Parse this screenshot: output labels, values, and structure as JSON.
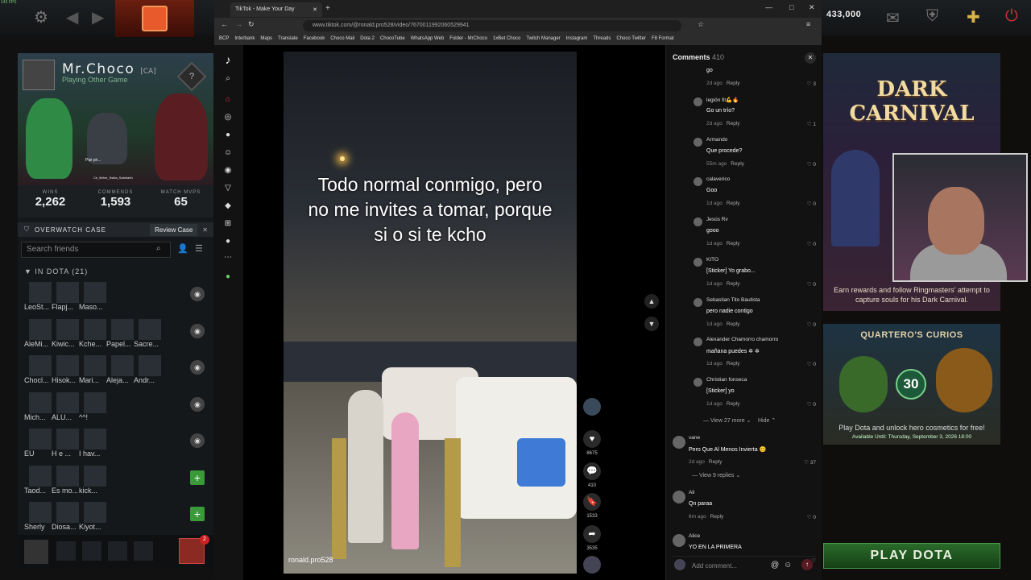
{
  "fps": "143 FPS",
  "gold": "433,000",
  "profile": {
    "name": "Mr.Choco",
    "tag": "[CA]",
    "status": "Playing Other Game",
    "bubble1": "Pipi pri...",
    "bubble2": "Ce_fiebre_Ssiba_Sabelahh"
  },
  "stats": [
    {
      "label": "WINS",
      "value": "2,262"
    },
    {
      "label": "COMMENDS",
      "value": "1,593"
    },
    {
      "label": "MATCH MVPS",
      "value": "65"
    }
  ],
  "overwatch": {
    "title": "OVERWATCH CASE",
    "review": "Review Case"
  },
  "friends": {
    "search_placeholder": "Search friends",
    "group": "IN DOTA (21)",
    "rows": [
      {
        "names": [
          "LeoSt...",
          "Flapj...",
          "Maso..."
        ]
      },
      {
        "names": [
          "AleMi...",
          "Kiwic...",
          "Kche...",
          "Papel...",
          "Sacre..."
        ]
      },
      {
        "names": [
          "Chocl...",
          "Hisok...",
          "Mari...",
          "Aleja...",
          "Andr..."
        ]
      },
      {
        "names": [
          "Mich...",
          "ALU...",
          "^^!"
        ]
      },
      {
        "names": [
          "EU",
          "H e ...",
          "I hav..."
        ]
      },
      {
        "names": [
          "Taod...",
          "Es mo...",
          "kick..."
        ]
      },
      {
        "names": [
          "Sherly",
          "Diosa...",
          "Kiyot..."
        ]
      }
    ]
  },
  "bottom_badge": "2",
  "browser": {
    "tab": "TikTok - Make Your Day",
    "url": "www.tiktok.com/@ronald.pro528/video/7670011992060529941",
    "bookmarks": [
      "BCP",
      "Interbank",
      "Maps",
      "Translate",
      "Facebook",
      "Choco Mail",
      "Dota 2",
      "ChocoTube",
      "WhatsApp Web",
      "Folder - MrChoco",
      "1xBet Choco",
      "Twitch Manager",
      "Instagram",
      "Threads",
      "Choco Twitter",
      "F8 Format"
    ]
  },
  "video": {
    "caption": "Todo normal conmigo, pero no me invites a tomar, porque si o si te kcho",
    "username": "ronald.pro528",
    "likes": "8675",
    "comments": "410",
    "saves": "1533",
    "shares": "3535"
  },
  "comments": {
    "title": "Comments",
    "count": "410",
    "placeholder": "Add comment...",
    "replies": [
      {
        "user": "",
        "text": "go",
        "meta": "2d ago",
        "reply": "Reply",
        "likes": "3"
      },
      {
        "user": "legión fit💪🔥",
        "text": "Go un trío?",
        "meta": "2d ago",
        "reply": "Reply",
        "likes": "1"
      },
      {
        "user": "Armando",
        "text": "Que procede?",
        "meta": "55m ago",
        "reply": "Reply",
        "likes": "0"
      },
      {
        "user": "calaverico",
        "text": "Goo",
        "meta": "1d ago",
        "reply": "Reply",
        "likes": "0"
      },
      {
        "user": "Jesús Rv",
        "text": "gooo",
        "meta": "1d ago",
        "reply": "Reply",
        "likes": "0"
      },
      {
        "user": "KITO",
        "text": "[Sticker] Yo grabo...",
        "meta": "1d ago",
        "reply": "Reply",
        "likes": "0"
      },
      {
        "user": "Sebastian Tito Bautista",
        "text": "pero nadie contigo",
        "meta": "1d ago",
        "reply": "Reply",
        "likes": "0"
      },
      {
        "user": "Alexander Chamorro chamorro",
        "text": "mañana puedes ✲ ✲",
        "meta": "1d ago",
        "reply": "Reply",
        "likes": "0"
      },
      {
        "user": "Christian fonseca",
        "text": "[Sticker] yo",
        "meta": "1d ago",
        "reply": "Reply",
        "likes": "0"
      }
    ],
    "view_more": "View 27 more",
    "hide": "Hide",
    "top": [
      {
        "user": "vane",
        "text": "Pero Que Al Menos Invierta 😊",
        "meta": "2d ago",
        "reply": "Reply",
        "likes": "37",
        "view": "View 9 replies"
      },
      {
        "user": "Ali",
        "text": "Qn paraa",
        "meta": "6m ago",
        "reply": "Reply",
        "likes": "0"
      },
      {
        "user": "Alice",
        "text": "YO EN LA PRIMERA",
        "meta": "",
        "reply": "",
        "likes": ""
      }
    ]
  },
  "event": {
    "title_line1": "DARK",
    "title_line2": "CARNIVAL",
    "text": "Earn rewards and follow Ringmasters' attempt to capture souls for his Dark Carnival."
  },
  "curios": {
    "title": "QUARTERO'S CURIOS",
    "badge": "30",
    "text": "Play Dota and unlock hero cosmetics for free!",
    "avail": "Available Until: Thursday, September 3, 2026 18:00"
  },
  "play": "PLAY DOTA"
}
